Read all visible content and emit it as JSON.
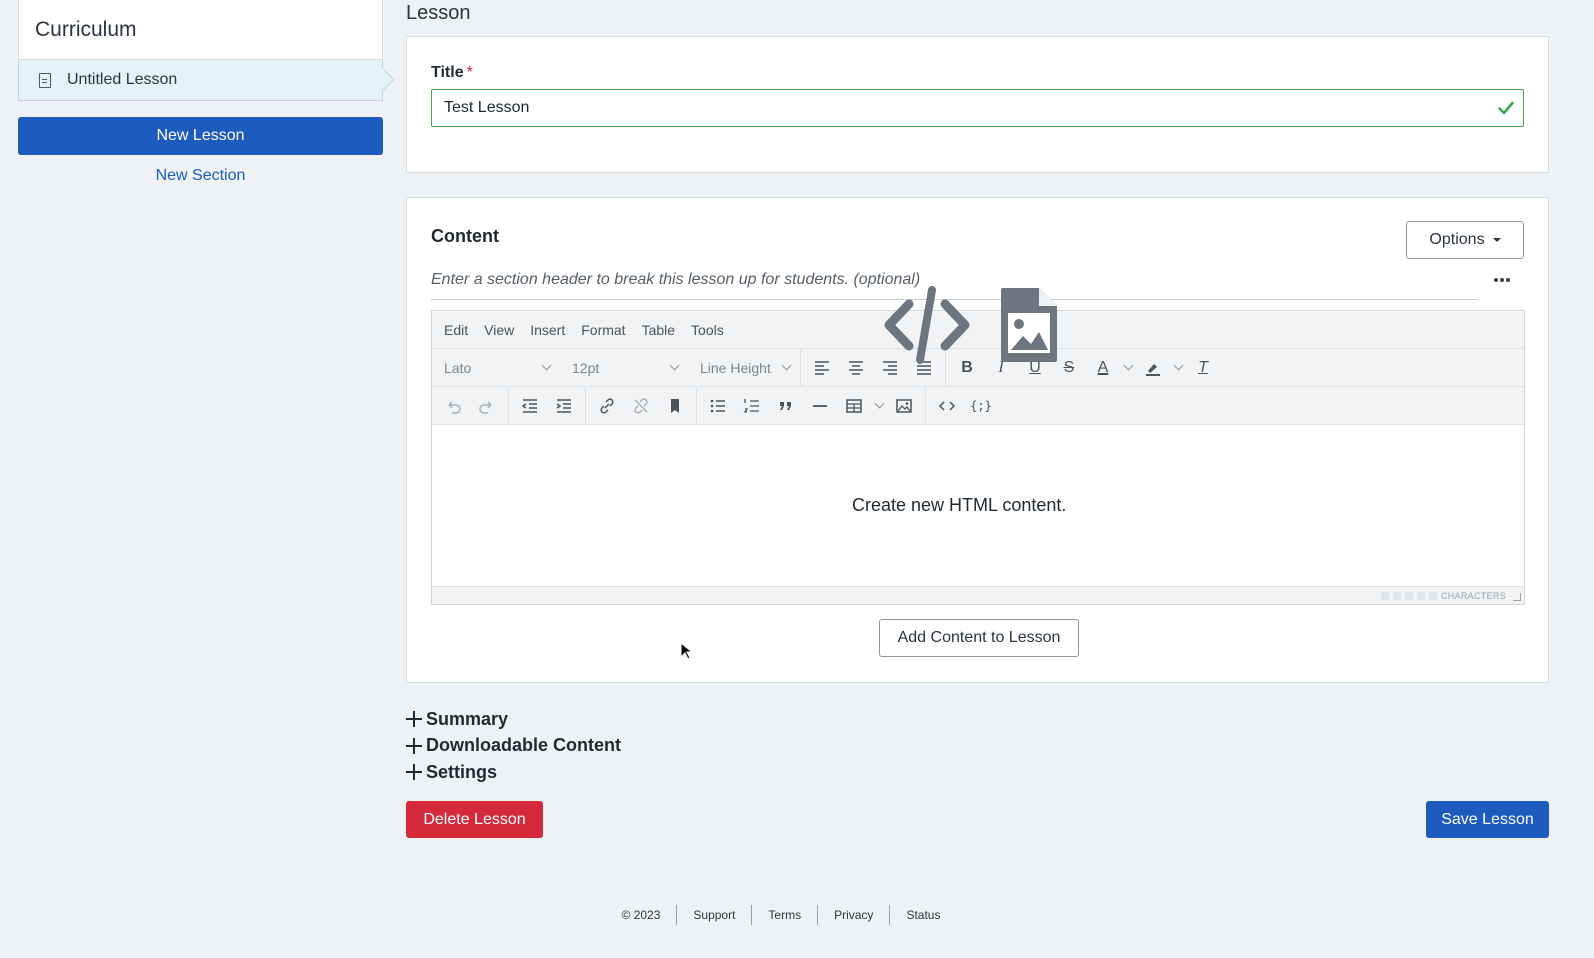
{
  "sidebar": {
    "heading": "Curriculum",
    "items": [
      {
        "label": "Untitled Lesson",
        "icon": "document-icon",
        "selected": true
      }
    ],
    "new_lesson_label": "New Lesson",
    "new_section_label": "New Section"
  },
  "main": {
    "heading": "Lesson",
    "title_label": "Title",
    "required_mark": "*",
    "title_value": "Test Lesson",
    "content_heading": "Content",
    "options_label": "Options",
    "section_header_placeholder": "Enter a section header to break this lesson up for students. (optional)"
  },
  "editor": {
    "menus": [
      "Edit",
      "View",
      "Insert",
      "Format",
      "Table",
      "Tools"
    ],
    "font_family": "Lato",
    "font_size": "12pt",
    "line_height": "Line Height",
    "status_label": "CHARACTERS"
  },
  "empty_state": {
    "text": "Create new HTML content.",
    "icons": [
      "code-icon",
      "image-file-icon"
    ]
  },
  "add_content_label": "Add Content to Lesson",
  "collapsibles": [
    "Summary",
    "Downloadable Content",
    "Settings"
  ],
  "actions": {
    "delete_label": "Delete Lesson",
    "save_label": "Save Lesson"
  },
  "footer": [
    "© 2023",
    "Support",
    "Terms",
    "Privacy",
    "Status"
  ],
  "colors": {
    "primary": "#1d5bbf",
    "danger": "#d42a3c",
    "success": "#3fa84b",
    "background": "#eef2f4",
    "selected_item": "#e3f3f8"
  }
}
